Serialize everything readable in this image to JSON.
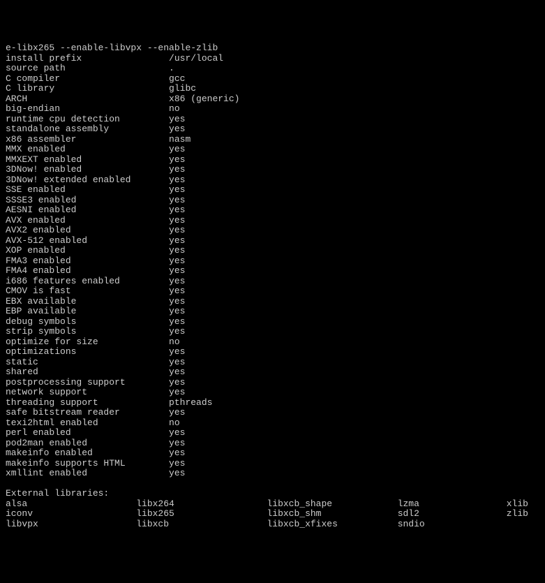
{
  "header": "e-libx265 --enable-libvpx --enable-zlib",
  "config": [
    {
      "key": "install prefix",
      "val": "/usr/local"
    },
    {
      "key": "source path",
      "val": "."
    },
    {
      "key": "C compiler",
      "val": "gcc"
    },
    {
      "key": "C library",
      "val": "glibc"
    },
    {
      "key": "ARCH",
      "val": "x86 (generic)"
    },
    {
      "key": "big-endian",
      "val": "no"
    },
    {
      "key": "runtime cpu detection",
      "val": "yes"
    },
    {
      "key": "standalone assembly",
      "val": "yes"
    },
    {
      "key": "x86 assembler",
      "val": "nasm"
    },
    {
      "key": "MMX enabled",
      "val": "yes"
    },
    {
      "key": "MMXEXT enabled",
      "val": "yes"
    },
    {
      "key": "3DNow! enabled",
      "val": "yes"
    },
    {
      "key": "3DNow! extended enabled",
      "val": "yes"
    },
    {
      "key": "SSE enabled",
      "val": "yes"
    },
    {
      "key": "SSSE3 enabled",
      "val": "yes"
    },
    {
      "key": "AESNI enabled",
      "val": "yes"
    },
    {
      "key": "AVX enabled",
      "val": "yes"
    },
    {
      "key": "AVX2 enabled",
      "val": "yes"
    },
    {
      "key": "AVX-512 enabled",
      "val": "yes"
    },
    {
      "key": "XOP enabled",
      "val": "yes"
    },
    {
      "key": "FMA3 enabled",
      "val": "yes"
    },
    {
      "key": "FMA4 enabled",
      "val": "yes"
    },
    {
      "key": "i686 features enabled",
      "val": "yes"
    },
    {
      "key": "CMOV is fast",
      "val": "yes"
    },
    {
      "key": "EBX available",
      "val": "yes"
    },
    {
      "key": "EBP available",
      "val": "yes"
    },
    {
      "key": "debug symbols",
      "val": "yes"
    },
    {
      "key": "strip symbols",
      "val": "yes"
    },
    {
      "key": "optimize for size",
      "val": "no"
    },
    {
      "key": "optimizations",
      "val": "yes"
    },
    {
      "key": "static",
      "val": "yes"
    },
    {
      "key": "shared",
      "val": "yes"
    },
    {
      "key": "postprocessing support",
      "val": "yes"
    },
    {
      "key": "network support",
      "val": "yes"
    },
    {
      "key": "threading support",
      "val": "pthreads"
    },
    {
      "key": "safe bitstream reader",
      "val": "yes"
    },
    {
      "key": "texi2html enabled",
      "val": "no"
    },
    {
      "key": "perl enabled",
      "val": "yes"
    },
    {
      "key": "pod2man enabled",
      "val": "yes"
    },
    {
      "key": "makeinfo enabled",
      "val": "yes"
    },
    {
      "key": "makeinfo supports HTML",
      "val": "yes"
    },
    {
      "key": "xmllint enabled",
      "val": "yes"
    }
  ],
  "ext_libs_heading": "External libraries:",
  "ext_libs_columns": [
    [
      "alsa",
      "iconv",
      "libvpx"
    ],
    [
      "libx264",
      "libx265",
      "libxcb"
    ],
    [
      "libxcb_shape",
      "libxcb_shm",
      "libxcb_xfixes"
    ],
    [
      "lzma",
      "sdl2",
      "sndio"
    ],
    [
      "xlib",
      "zlib"
    ]
  ],
  "layout": {
    "config_key_width": 30,
    "libs_col_width": 24,
    "libs_col4_width": 20
  }
}
